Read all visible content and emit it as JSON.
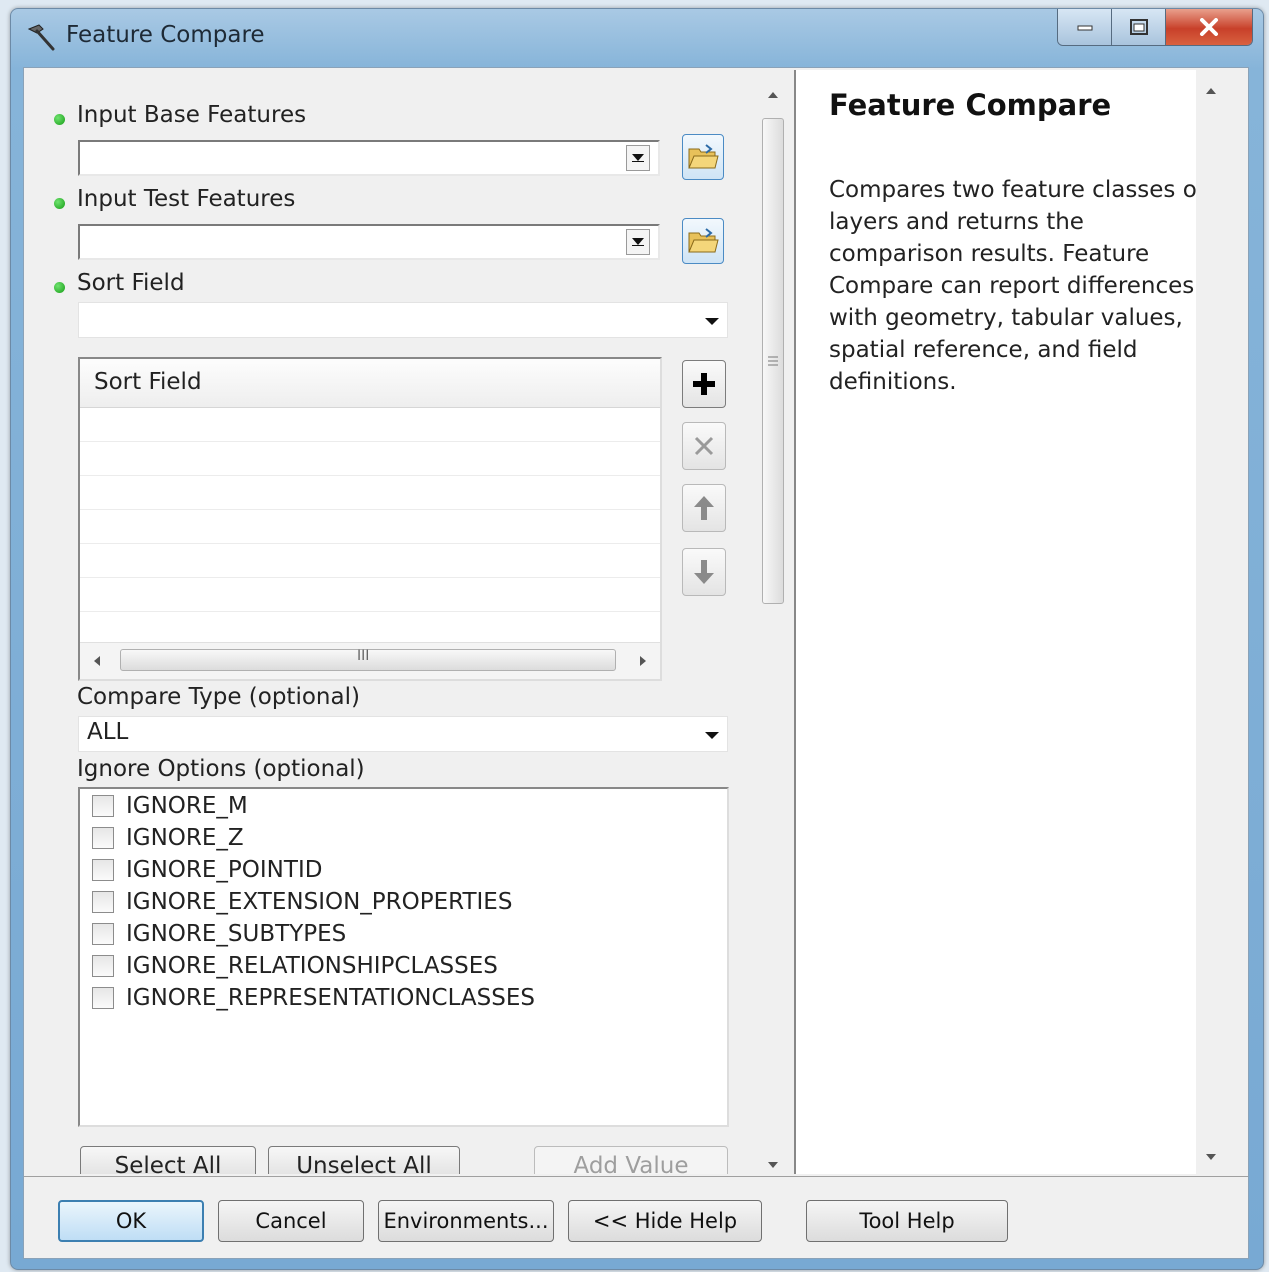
{
  "window": {
    "title": "Feature Compare",
    "icon": "hammer-icon",
    "controls": [
      "minimize-icon",
      "maximize-icon",
      "close-icon"
    ]
  },
  "params": {
    "input_base": {
      "label": "Input Base Features",
      "value": ""
    },
    "input_test": {
      "label": "Input Test Features",
      "value": ""
    },
    "sort_field": {
      "label": "Sort Field",
      "value": "",
      "table_header": "Sort Field",
      "scroll_grip": "III",
      "row_buttons": [
        "add-icon",
        "remove-icon",
        "move-up-icon",
        "move-down-icon"
      ]
    },
    "compare_type": {
      "label": "Compare Type (optional)",
      "value": "ALL"
    },
    "ignore_options": {
      "label": "Ignore Options (optional)",
      "items": [
        {
          "label": "IGNORE_M",
          "checked": false
        },
        {
          "label": "IGNORE_Z",
          "checked": false
        },
        {
          "label": "IGNORE_POINTID",
          "checked": false
        },
        {
          "label": "IGNORE_EXTENSION_PROPERTIES",
          "checked": false
        },
        {
          "label": "IGNORE_SUBTYPES",
          "checked": false
        },
        {
          "label": "IGNORE_RELATIONSHIPCLASSES",
          "checked": false
        },
        {
          "label": "IGNORE_REPRESENTATIONCLASSES",
          "checked": false
        }
      ]
    },
    "buttons": {
      "select_all": "Select All",
      "unselect_all": "Unselect All",
      "add_value": "Add Value"
    }
  },
  "help": {
    "title": "Feature Compare",
    "text": "Compares two feature classes or layers and returns the comparison results. Feature Compare can report differences with geometry, tabular values, spatial reference, and field definitions."
  },
  "footer": {
    "ok": "OK",
    "cancel": "Cancel",
    "environments": "Environments...",
    "hide_help": "<< Hide Help",
    "tool_help": "Tool Help"
  },
  "colors": {
    "required_dot": "#169c16",
    "default_button": "#3c7fb1",
    "close_button": "#c8402a"
  }
}
